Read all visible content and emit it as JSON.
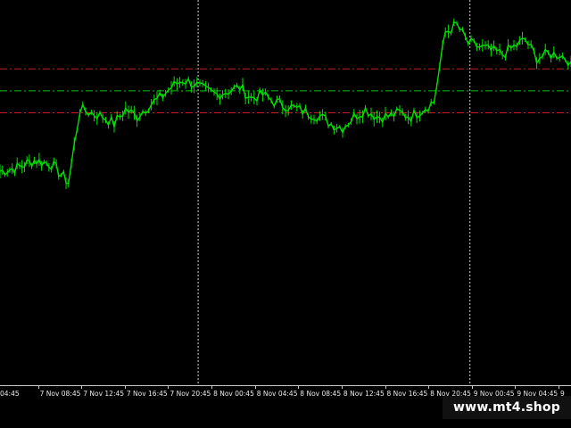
{
  "chart_data": {
    "type": "line",
    "title": "",
    "colors": {
      "background": "#000000",
      "price": "#00e000",
      "level_main": "#00c800",
      "level_band": "#c81e1e",
      "separator": "#cfcfcf",
      "axis_text": "#e8e8e8"
    },
    "ylim": [
      0,
      100
    ],
    "x_tick_labels": [
      "04:45",
      "7 Nov 08:45",
      "7 Nov 12:45",
      "7 Nov 16:45",
      "7 Nov 20:45",
      "8 Nov 00:45",
      "8 Nov 04:45",
      "8 Nov 08:45",
      "8 Nov 12:45",
      "8 Nov 16:45",
      "8 Nov 20:45",
      "9 Nov 00:45",
      "9 Nov 04:45",
      "9"
    ],
    "series": [
      {
        "x": [
          0,
          3,
          6,
          9,
          12,
          14,
          16,
          18,
          20,
          22,
          24,
          26,
          28,
          30,
          32,
          34,
          36,
          38,
          40,
          42,
          44,
          46,
          48,
          50,
          52,
          54,
          56,
          58,
          60,
          62,
          64,
          66,
          68,
          70,
          72,
          74,
          76,
          78,
          80,
          82,
          84,
          86,
          88,
          90,
          92,
          94,
          96,
          98,
          100
        ],
        "values": [
          56,
          57,
          59,
          58,
          53,
          73,
          72,
          71,
          69,
          73,
          71,
          74,
          76,
          79,
          81,
          80,
          78,
          77,
          78,
          79,
          76,
          77,
          75,
          74,
          73,
          72,
          71,
          69,
          68,
          71,
          73,
          71,
          71,
          72,
          71,
          73,
          75,
          94,
          96,
          91,
          90,
          89,
          88,
          90,
          92,
          87,
          88,
          88,
          86
        ]
      }
    ],
    "horizontal_levels": [
      {
        "value": 78,
        "style": "dash-dot",
        "color_key": "level_main"
      },
      {
        "value": 84,
        "style": "dash-dot",
        "color_key": "level_band"
      },
      {
        "value": 72,
        "style": "dash-dot",
        "color_key": "level_band"
      }
    ],
    "day_separators": [
      34.7,
      82.3
    ],
    "grid": false
  },
  "watermark": "www.mt4.shop"
}
